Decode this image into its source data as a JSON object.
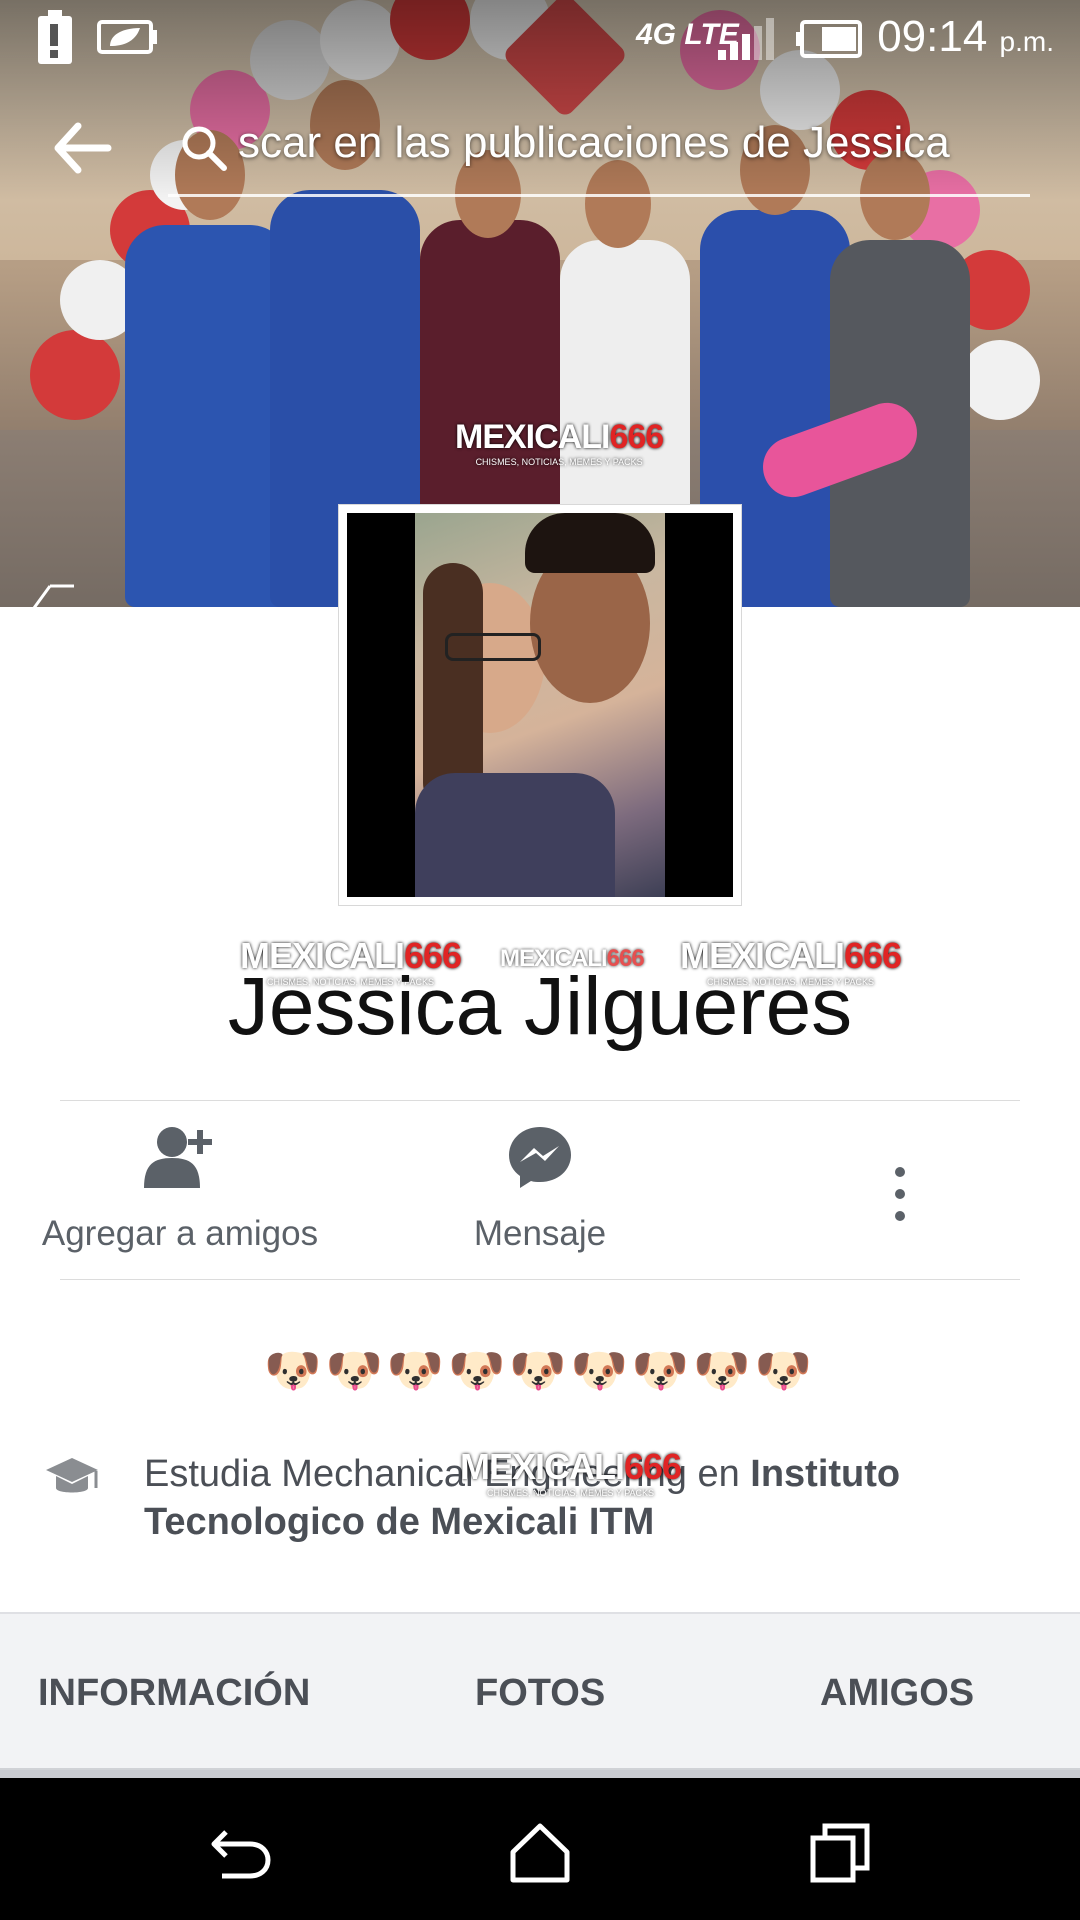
{
  "status_bar": {
    "network": "4G LTE",
    "time": "09:14",
    "time_suffix": "p.m."
  },
  "search": {
    "placeholder": "Buscar en las publicaciones de Jessica",
    "visible_text": "scar en las publicaciones de Jessica"
  },
  "watermark": {
    "brand": "MEXICALI",
    "number": "666",
    "tagline": "CHISMES, NOTICIAS, MEMES Y PACKS"
  },
  "profile": {
    "name": "Jessica Jilgueres"
  },
  "actions": {
    "add_friend": "Agregar a amigos",
    "message": "Mensaje"
  },
  "bio": {
    "emoji_line": "🐶🐶🐶🐶🐶🐶🐶🐶🐶",
    "edu_prefix": "Estudia Mechanical Engineering en ",
    "edu_school": "Instituto Tecnologico de Mexicali ITM"
  },
  "tabs": {
    "info": "INFORMACIÓN",
    "photos": "FOTOS",
    "friends": "AMIGOS"
  },
  "colors": {
    "accent_red": "#e02424",
    "text_gray": "#4b4f56",
    "icon_gray": "#5b6168",
    "tab_background": "#f2f3f5"
  }
}
